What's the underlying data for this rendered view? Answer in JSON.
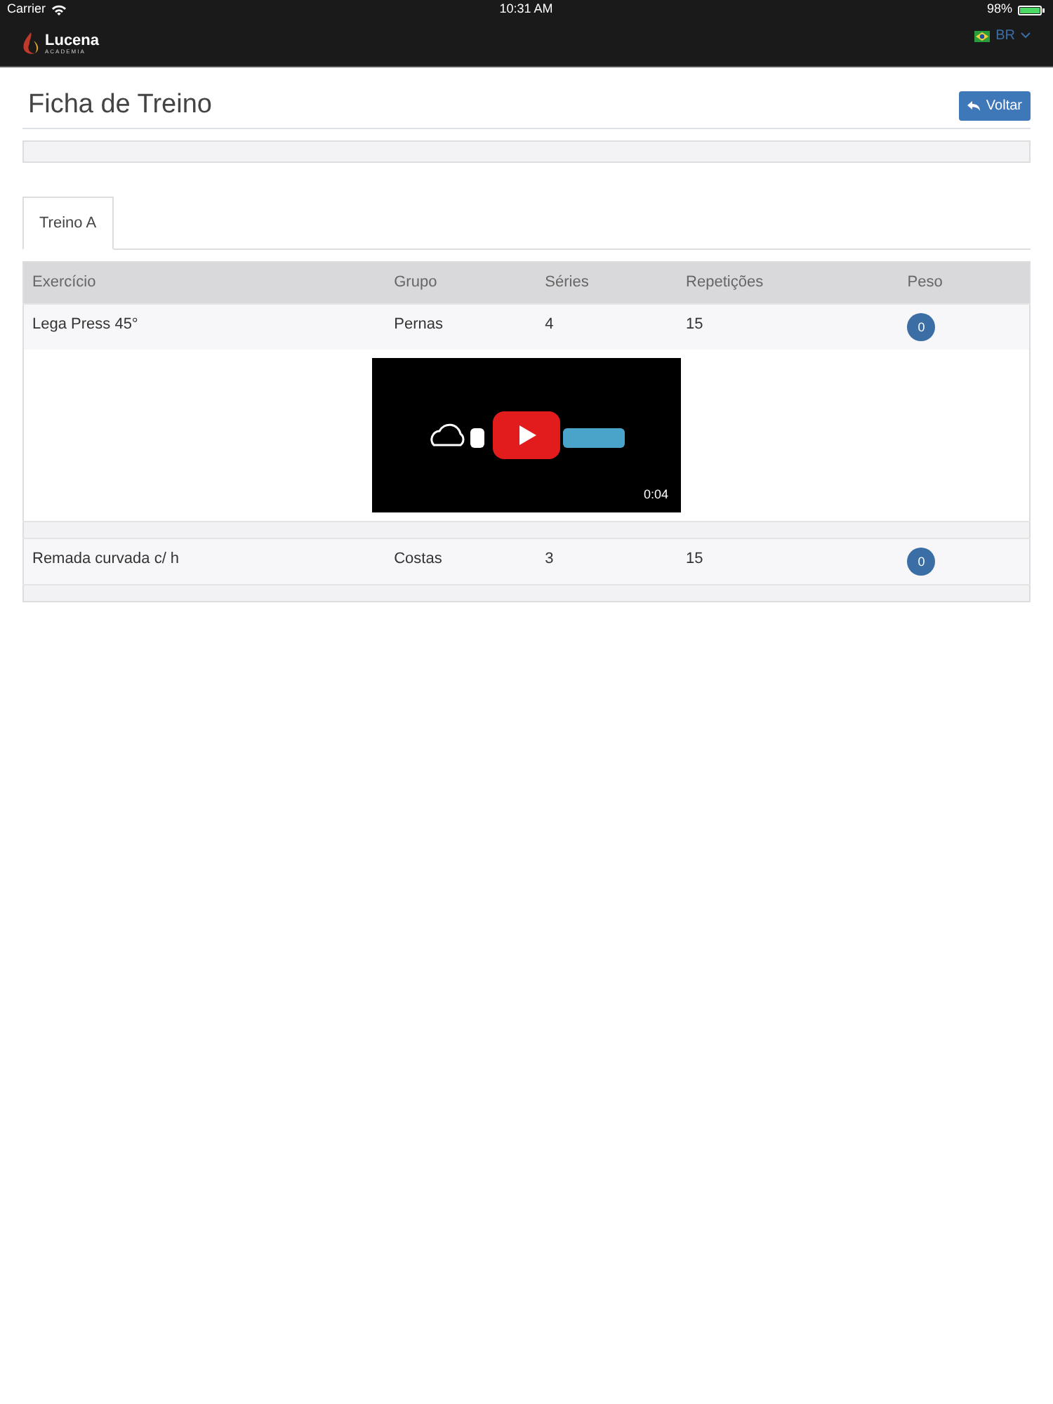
{
  "status_bar": {
    "carrier": "Carrier",
    "time": "10:31 AM",
    "battery": "98%"
  },
  "navbar": {
    "brand": "Lucena",
    "brand_sub": "ACADEMIA",
    "language": "BR"
  },
  "page": {
    "title": "Ficha de Treino",
    "back_button": "Voltar"
  },
  "tabs": [
    {
      "label": "Treino A",
      "selected": true
    }
  ],
  "table": {
    "columns": [
      "Exercício",
      "Grupo",
      "Séries",
      "Repetições",
      "Peso"
    ],
    "rows": [
      {
        "exercise": "Lega Press 45°",
        "group": "Pernas",
        "series": "4",
        "reps": "15",
        "weight": "0",
        "video": {
          "duration": "0:04"
        }
      },
      {
        "exercise": "Remada curvada c/ h",
        "group": "Costas",
        "series": "3",
        "reps": "15",
        "weight": "0"
      }
    ]
  }
}
